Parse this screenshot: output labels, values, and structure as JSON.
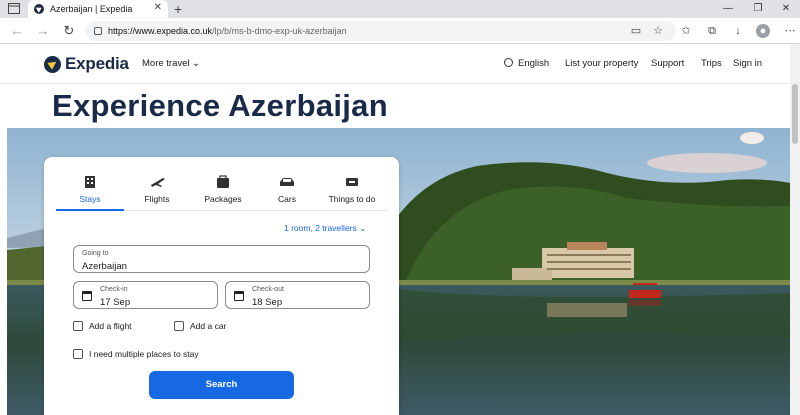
{
  "browser": {
    "tab_title": "Azerbaijan | Expedia",
    "tab_close": "✕",
    "new_tab": "+",
    "url_host": "https://www.expedia.co.uk",
    "url_path": "/lp/b/ms-b-dmo-exp-uk-azerbaijan",
    "window_controls": [
      "—",
      "❐",
      "✕"
    ]
  },
  "header": {
    "logo_text": "Expedia",
    "more_travel": "More travel",
    "language": "English",
    "list_property": "List your property",
    "support": "Support",
    "trips": "Trips",
    "sign_in": "Sign in"
  },
  "page": {
    "title": "Experience Azerbaijan"
  },
  "search": {
    "tabs": [
      {
        "label": "Stays",
        "icon": "building-icon",
        "active": true
      },
      {
        "label": "Flights",
        "icon": "plane-icon"
      },
      {
        "label": "Packages",
        "icon": "package-icon"
      },
      {
        "label": "Cars",
        "icon": "car-icon"
      },
      {
        "label": "Things to do",
        "icon": "ticket-icon"
      }
    ],
    "travellers": "1 room, 2 travellers",
    "going_to": {
      "label": "Going to",
      "value": "Azerbaijan"
    },
    "check_in": {
      "label": "Check-in",
      "value": "17 Sep"
    },
    "check_out": {
      "label": "Check-out",
      "value": "18 Sep"
    },
    "add_flight": "Add a flight",
    "add_car": "Add a car",
    "multiple_places": "I need multiple places to stay",
    "button": "Search"
  },
  "colors": {
    "brand_navy": "#1a2b49",
    "brand_yellow": "#fbcc33",
    "accent_blue": "#1668e3"
  }
}
